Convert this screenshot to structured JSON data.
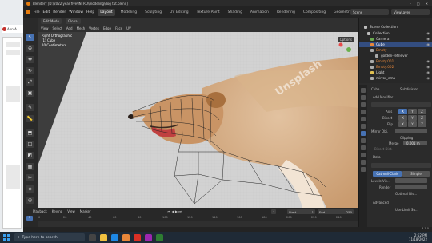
{
  "browser_tab": {
    "label": "Ann A"
  },
  "window": {
    "title": "Blender* [D:\\2022 year five\\INTRO\\modeling\\dog tut.blend]"
  },
  "menus": [
    "File",
    "Edit",
    "Render",
    "Window",
    "Help"
  ],
  "workspaces": [
    "Layout",
    "Modeling",
    "Sculpting",
    "UV Editing",
    "Texture Paint",
    "Shading",
    "Animation",
    "Rendering",
    "Compositing",
    "Geometry Nodes",
    "Scripting"
  ],
  "scene": "Scene",
  "view_layer": "ViewLayer",
  "viewport": {
    "mode": "Edit Mode",
    "menus": [
      "View",
      "Select",
      "Add",
      "Mesh",
      "Vertex",
      "Edge",
      "Face",
      "UV"
    ],
    "transform": "Global",
    "view_name": "Right Orthographic",
    "object_line": "(1) Cube",
    "units_line": "10 Centimeters",
    "options_label": "Options",
    "watermark": "Unsplash"
  },
  "outliner": {
    "items": [
      {
        "label": "Scene Collection",
        "color": "#bbbbbb"
      },
      {
        "label": "Collection",
        "color": "#bbbbbb"
      },
      {
        "label": "Camera",
        "color": "#6aa84f"
      },
      {
        "label": "Cube",
        "color": "#e8873a"
      },
      {
        "label": "Empty",
        "color": "#aaaaaa"
      },
      {
        "label": "golden-retriever",
        "color": "#aaaaaa"
      },
      {
        "label": "Empty.001",
        "color": "#aaaaaa"
      },
      {
        "label": "Empty.002",
        "color": "#aaaaaa"
      },
      {
        "label": "Light",
        "color": "#e0c050"
      },
      {
        "label": "mirror_ema",
        "color": "#aaaaaa"
      }
    ]
  },
  "properties": {
    "object_name": "Cube",
    "modifier_name": "Subdivision",
    "add_modifier": "Add Modifier",
    "mirror_labels": [
      "Axis",
      "Bisect",
      "Flip"
    ],
    "axes": [
      "X",
      "Y",
      "Z"
    ],
    "mirror_object": "Mirror Obj.",
    "clipping": "Clipping",
    "merge": "Merge",
    "merge_value": "0.001 m",
    "bisect_distance": "Bisect Dist.",
    "data": "Data",
    "subdiv_tabs": [
      "Catmull-Clark",
      "Simple"
    ],
    "levels_viewport": "Levels Vie...",
    "render": "Render",
    "optimal": "Optimal Dis...",
    "advanced": "Advanced",
    "use_limit": "Use Limit Su..."
  },
  "timeline": {
    "menus": [
      "Playback",
      "Keying",
      "View",
      "Marker"
    ],
    "current_frame": "1",
    "start_label": "Start",
    "start": "1",
    "end_label": "End",
    "end": "250",
    "ticks": [
      "0",
      "20",
      "40",
      "60",
      "80",
      "100",
      "120",
      "140",
      "160",
      "180",
      "200",
      "220",
      "240"
    ]
  },
  "status": {
    "version": "3.1.0"
  },
  "taskbar": {
    "search": "Type here to search",
    "time": "2:52 PM",
    "date": "11/18/2022"
  }
}
